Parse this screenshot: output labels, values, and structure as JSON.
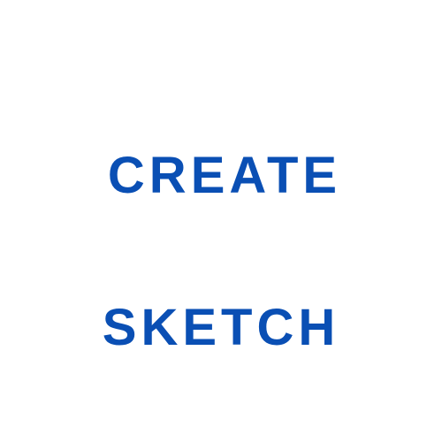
{
  "words": {
    "create": "CREATE",
    "sketch": "SKETCH"
  },
  "colors": {
    "text": "#0a4fb4",
    "background": "#ffffff"
  }
}
